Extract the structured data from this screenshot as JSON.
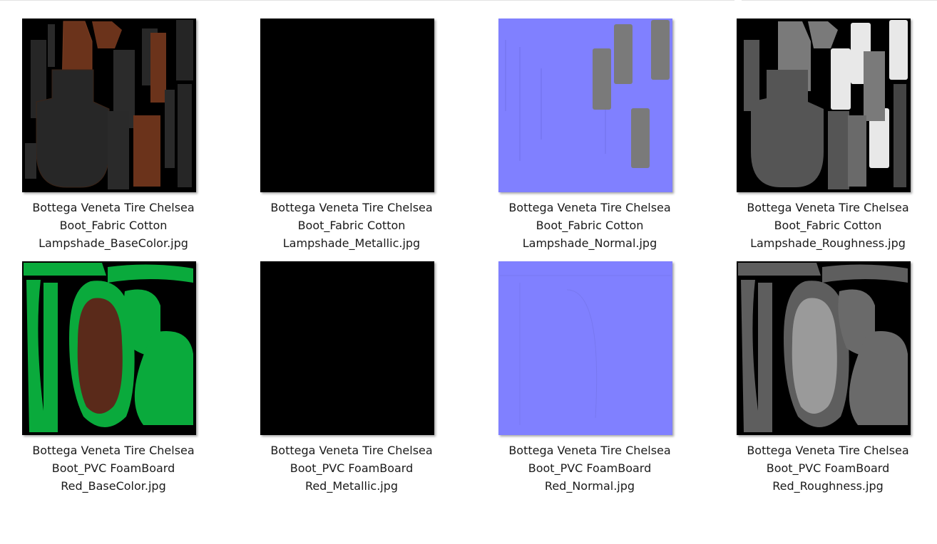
{
  "files": [
    {
      "line1": "Bottega Veneta Tire Chelsea",
      "line2": "Boot_Fabric Cotton",
      "line3": "Lampshade_BaseColor.jpg",
      "kind": "fabric-basecolor"
    },
    {
      "line1": "Bottega Veneta Tire Chelsea",
      "line2": "Boot_Fabric Cotton",
      "line3": "Lampshade_Metallic.jpg",
      "kind": "metallic"
    },
    {
      "line1": "Bottega Veneta Tire Chelsea",
      "line2": "Boot_Fabric Cotton",
      "line3": "Lampshade_Normal.jpg",
      "kind": "fabric-normal"
    },
    {
      "line1": "Bottega Veneta Tire Chelsea",
      "line2": "Boot_Fabric Cotton",
      "line3": "Lampshade_Roughness.jpg",
      "kind": "fabric-roughness"
    },
    {
      "line1": "Bottega Veneta Tire Chelsea",
      "line2": "Boot_PVC FoamBoard",
      "line3": "Red_BaseColor.jpg",
      "kind": "pvc-basecolor"
    },
    {
      "line1": "Bottega Veneta Tire Chelsea",
      "line2": "Boot_PVC FoamBoard",
      "line3": "Red_Metallic.jpg",
      "kind": "metallic"
    },
    {
      "line1": "Bottega Veneta Tire Chelsea",
      "line2": "Boot_PVC FoamBoard",
      "line3": "Red_Normal.jpg",
      "kind": "pvc-normal"
    },
    {
      "line1": "Bottega Veneta Tire Chelsea",
      "line2": "Boot_PVC FoamBoard",
      "line3": "Red_Roughness.jpg",
      "kind": "pvc-roughness"
    }
  ],
  "colors": {
    "black": "#000000",
    "fabric_dark": "#262626",
    "fabric_brown": "#6b331b",
    "normal_blue": "#8080ff",
    "pvc_green": "#0aaa3c",
    "pvc_brown": "#5a2a1a",
    "rough_gray": "#555555",
    "rough_light": "#e8e8e8",
    "rough_mid": "#7a7a7a"
  }
}
